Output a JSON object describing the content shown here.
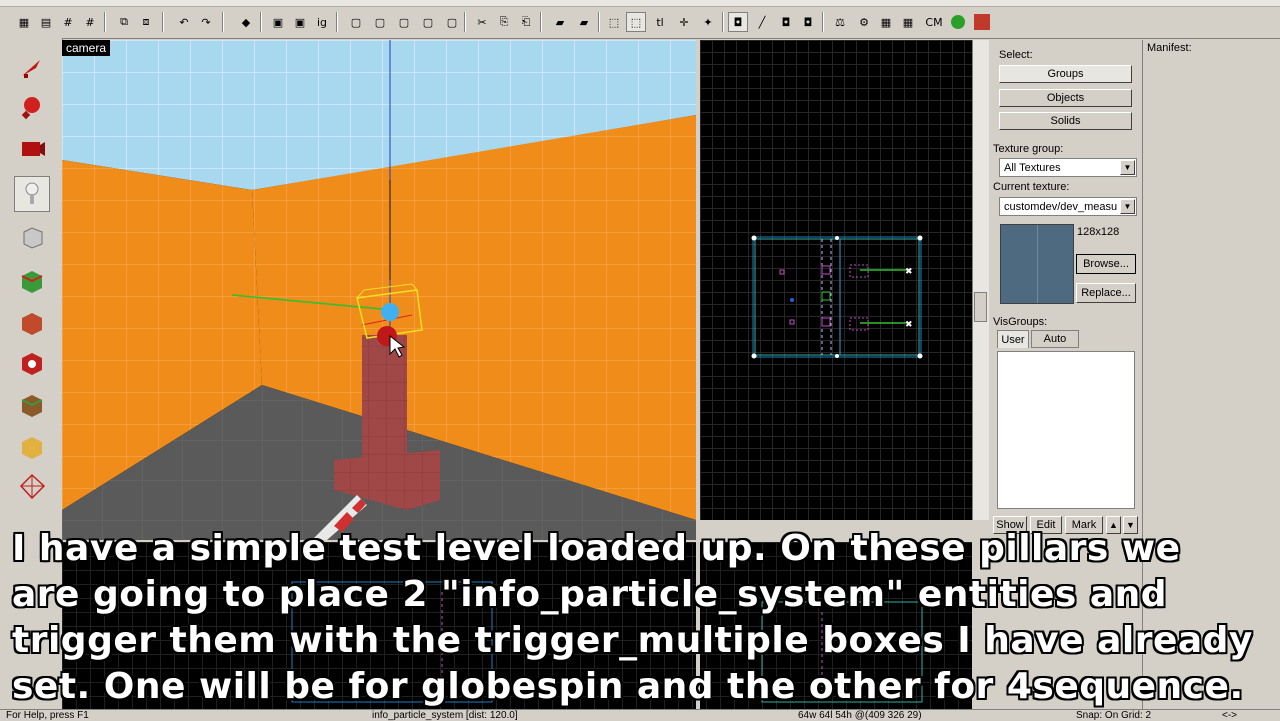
{
  "viewport3d": {
    "camera_label": "camera"
  },
  "right_panel": {
    "select_label": "Select:",
    "buttons": {
      "groups": "Groups",
      "objects": "Objects",
      "solids": "Solids"
    },
    "texture_group_label": "Texture group:",
    "texture_group_value": "All Textures",
    "current_texture_label": "Current texture:",
    "current_texture_value": "customdev/dev_measu",
    "texture_size": "128x128",
    "browse_button": "Browse...",
    "replace_button": "Replace...",
    "visgroups_label": "VisGroups:",
    "tabs": {
      "user": "User",
      "auto": "Auto"
    },
    "show_button": "Show",
    "edit_button": "Edit",
    "mark_button": "Mark",
    "up_arrow": "▲",
    "down_arrow": "▼"
  },
  "manifest": {
    "title": "Manifest:"
  },
  "statusbar": {
    "help": "For Help, press F1",
    "selection": "info_particle_system  [dist: 120.0]",
    "dimensions": "64w 64l 54h @(409 326 29)",
    "snap": "Snap: On Grid: 2",
    "arrows": "<->"
  },
  "caption": {
    "lines": [
      "I have a simple test level loaded up.  On these pillars we",
      "are going to place 2 \"info_particle_system\" entities and",
      "trigger them with the trigger_multiple boxes I have already",
      "set.  One will be for globespin and the other for 4sequence."
    ]
  },
  "toolbar": {
    "cm_label": "CM"
  },
  "colors": {
    "wall": "#f08c1a",
    "floor": "#5a5a5a",
    "ceiling": "#a8d8f0",
    "pillar": "#a04848"
  }
}
